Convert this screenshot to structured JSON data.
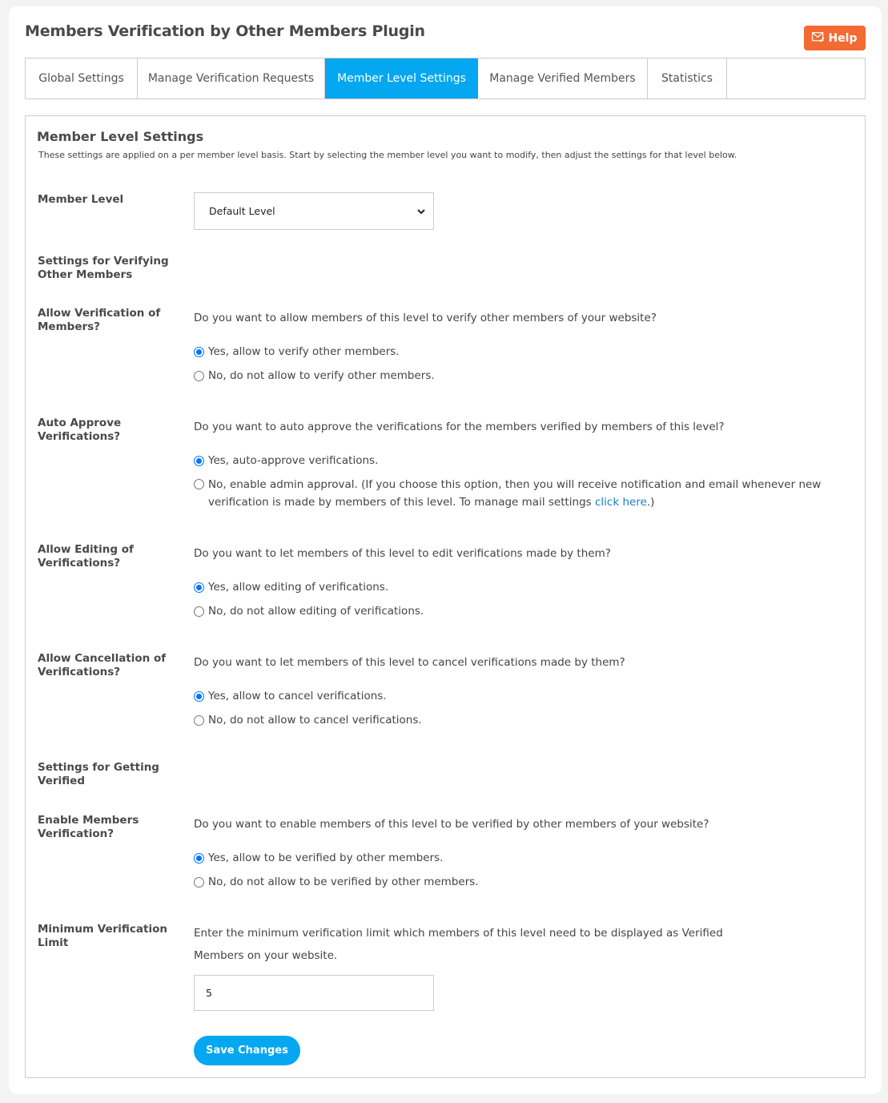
{
  "header": {
    "title": "Members Verification by Other Members Plugin",
    "help_label": "Help",
    "help_icon": "envelope-help-icon",
    "help_color": "#f26b32"
  },
  "tabs": [
    {
      "label": "Global Settings",
      "active": false
    },
    {
      "label": "Manage Verification Requests",
      "active": false
    },
    {
      "label": "Member Level Settings",
      "active": true
    },
    {
      "label": "Manage Verified Members",
      "active": false
    },
    {
      "label": "Statistics",
      "active": false
    }
  ],
  "accent_color": "#04a7f0",
  "panel": {
    "title": "Member Level Settings",
    "description": "These settings are applied on a per member level basis. Start by selecting the member level you want to modify, then adjust the settings for that level below.",
    "member_level": {
      "label": "Member Level",
      "selected": "Default Level"
    },
    "section_verifying": "Settings for Verifying Other Members",
    "allow_verification": {
      "label": "Allow Verification of Members?",
      "question": "Do you want to allow members of this level to verify other members of your website?",
      "options": [
        {
          "label": "Yes, allow to verify other members.",
          "checked": true
        },
        {
          "label": "No, do not allow to verify other members.",
          "checked": false
        }
      ]
    },
    "auto_approve": {
      "label": "Auto Approve Verifications?",
      "question": "Do you want to auto approve the verifications for the members verified by members of this level?",
      "options": [
        {
          "label": "Yes, auto-approve verifications.",
          "checked": true
        },
        {
          "label": "No, enable admin approval. (If you choose this option, then you will receive notification and email whenever new verification is made by members of this level. To manage mail settings ",
          "link": "click here",
          "suffix": ".)",
          "checked": false
        }
      ]
    },
    "allow_editing": {
      "label": "Allow Editing of Verifications?",
      "question": "Do you want to let members of this level to edit verifications made by them?",
      "options": [
        {
          "label": "Yes, allow editing of verifications.",
          "checked": true
        },
        {
          "label": "No, do not allow editing of verifications.",
          "checked": false
        }
      ]
    },
    "allow_cancellation": {
      "label": "Allow Cancellation of Verifications?",
      "question": "Do you want to let members of this level to cancel verifications made by them?",
      "options": [
        {
          "label": "Yes, allow to cancel verifications.",
          "checked": true
        },
        {
          "label": "No, do not allow to cancel verifications.",
          "checked": false
        }
      ]
    },
    "section_getting_verified": "Settings for Getting Verified",
    "enable_verification": {
      "label": "Enable Members Verification?",
      "question": "Do you want to enable members of this level to be verified by other members of your website?",
      "options": [
        {
          "label": "Yes, allow to be verified by other members.",
          "checked": true
        },
        {
          "label": "No, do not allow to be verified by other members.",
          "checked": false
        }
      ]
    },
    "min_limit": {
      "label": "Minimum Verification Limit",
      "question_line1": "Enter the minimum verification limit which members of this level need to be displayed as Verified",
      "question_line2": "Members on your website.",
      "value": "5"
    },
    "save_label": "Save Changes"
  }
}
